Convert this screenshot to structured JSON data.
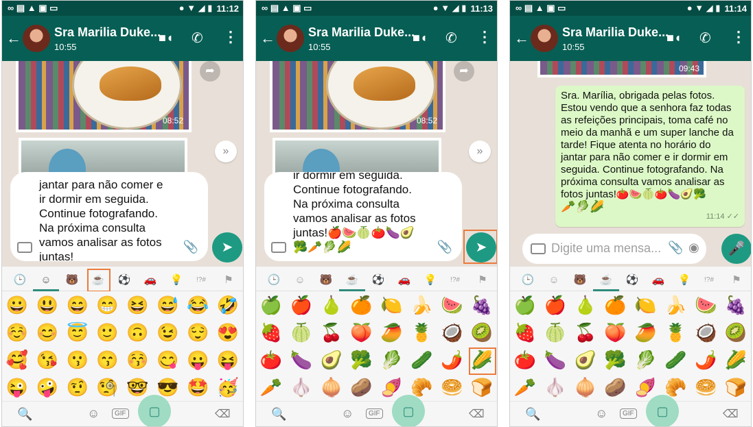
{
  "screens": [
    {
      "status_time": "11:12",
      "contact_name": "Sra Marilia Duke...",
      "contact_sub": "10:55",
      "photo_time": "08:52",
      "draft_text": "jantar para não comer e\nir dormir em seguida.\nContinue fotografando.\nNa próxima consulta\nvamos analisar as fotos\njuntas!",
      "categories": [
        "🕒",
        "☺",
        "🐻",
        "☕",
        "⚽",
        "🚗",
        "💡",
        "!?#",
        "⚑"
      ],
      "active_category_index": 1,
      "emoji_grid": [
        "😀",
        "😃",
        "😄",
        "😁",
        "😆",
        "😅",
        "😂",
        "🤣",
        "☺️",
        "😊",
        "😇",
        "🙂",
        "🙃",
        "😉",
        "😌",
        "😍",
        "🥰",
        "😘",
        "😗",
        "😙",
        "😚",
        "😋",
        "😛",
        "😝",
        "😜",
        "🤪",
        "🤨",
        "🧐",
        "🤓",
        "😎",
        "🤩",
        "🥳"
      ]
    },
    {
      "status_time": "11:13",
      "contact_name": "Sra Marilia Duke...",
      "contact_sub": "10:55",
      "photo_time": "08:52",
      "draft_text": "ir dormir em seguida.\nContinue fotografando.\nNa próxima consulta\nvamos analisar as fotos\njuntas!🍎🍉🍈🍅🍆🥑\n🥦🥕🥬🌽",
      "categories": [
        "🕒",
        "☺",
        "🐻",
        "☕",
        "⚽",
        "🚗",
        "💡",
        "!?#",
        "⚑"
      ],
      "active_category_index": 3,
      "emoji_grid": [
        "🍏",
        "🍎",
        "🍐",
        "🍊",
        "🍋",
        "🍌",
        "🍉",
        "🍇",
        "🍓",
        "🍈",
        "🍒",
        "🍑",
        "🥭",
        "🍍",
        "🥥",
        "🥝",
        "🍅",
        "🍆",
        "🥑",
        "🥦",
        "🥬",
        "🥒",
        "🌶️",
        "🌽",
        "🥕",
        "🧄",
        "🧅",
        "🥔",
        "🍠",
        "🥐",
        "🥯",
        "🍞"
      ]
    },
    {
      "status_time": "11:14",
      "contact_name": "Sra Marilia Duke...",
      "contact_sub": "10:55",
      "photo_time": "09:43",
      "message_text": "Sra. Marília, obrigada pelas fotos. Estou vendo que a senhora faz todas as refeições principais, toma café no meio da manhã e um super lanche da tarde! Fique atenta no horário do jantar para não comer e ir dormir em seguida. Continue fotografando. Na próxima consulta vamos analisar as fotos juntas!🍅🍉🍈🍅🍆🥑🥦",
      "message_emojis2": "🥕🥬🌽",
      "message_time": "11:14 ✓✓",
      "input_placeholder": "Digite uma mensa...",
      "categories": [
        "🕒",
        "☺",
        "🐻",
        "☕",
        "⚽",
        "🚗",
        "💡",
        "!?#",
        "⚑"
      ],
      "active_category_index": 3,
      "emoji_grid": [
        "🍏",
        "🍎",
        "🍐",
        "🍊",
        "🍋",
        "🍌",
        "🍉",
        "🍇",
        "🍓",
        "🍈",
        "🍒",
        "🍑",
        "🥭",
        "🍍",
        "🥥",
        "🥝",
        "🍅",
        "🍆",
        "🥑",
        "🥦",
        "🥬",
        "🥒",
        "🌶️",
        "🌽",
        "🥕",
        "🧄",
        "🧅",
        "🥔",
        "🍠",
        "🥐",
        "🥯",
        "🍞"
      ]
    }
  ],
  "icons": {
    "back": "←",
    "video": "■◖",
    "call": "✆",
    "more": "⋮",
    "forward": "➦",
    "scroll_down": "»",
    "send": "➤",
    "mic": "🎤",
    "clip": "📎",
    "camera": "◉",
    "search": "🔍",
    "smile": "☺",
    "gif": "GIF",
    "sticker": "▢",
    "backspace": "⌫"
  },
  "status_icons_left": "∞ ▤ ▲ ▣ ▭",
  "status_icons_right": "● ▼ ◢ ▮",
  "colors": {
    "header": "#075e54",
    "accent": "#1e9a83",
    "highlight": "#ea7b3c",
    "bubble": "#dcf8c6"
  }
}
